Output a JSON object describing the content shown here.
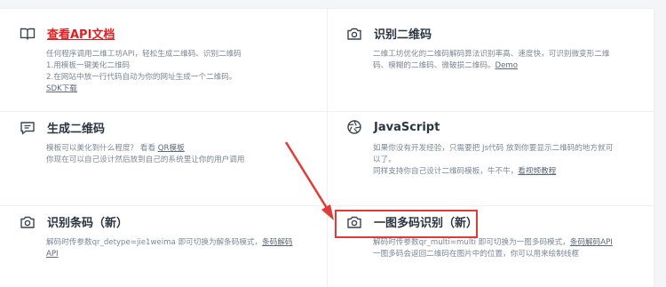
{
  "cards": {
    "api_docs": {
      "title": "查看API文档",
      "icon": "book-icon",
      "lines": [
        "任何程序调用二维工坊API，轻松生成二维码、识别二维码",
        "1.用模板一键美化二维码",
        "2.在网站中放一行代码自动为你的网址生成一个二维码。"
      ],
      "link": "SDK下载"
    },
    "recognize_qr": {
      "title": "识别二维码",
      "icon": "camera-icon",
      "lines": [
        "二维工坊优化的二维码解码算法识别率高、速度快，可识别微变形二维",
        "码、模糊的二维码、微破损二维码。"
      ],
      "link": "Demo"
    },
    "generate_qr": {
      "title": "生成二维码",
      "icon": "message-icon",
      "line1_prefix": "模板可以美化到什么程度？ 看看 ",
      "line1_link": "QR模板",
      "line2": "你现在可以自己设计然后放到自己的系统里让你的用户调用"
    },
    "javascript": {
      "title": "JavaScript",
      "icon": "aperture-icon",
      "lines": [
        "如果你没有开发经验，只需要把 Js代码 放到你要显示二维码的地方就可",
        "以了。"
      ],
      "line3_prefix": "同样支持你自己设计二维码模板，牛不牛，",
      "line3_link": "看视频教程"
    },
    "recognize_barcode": {
      "title": "识别条码（新）",
      "icon": "camera-icon",
      "line1_prefix": "解码时传参数qr_detype=jie1weima 即可切换为解条码模式，",
      "line1_link": "条码解码",
      "line2_link": "API"
    },
    "multi_qr": {
      "title": "一图多码识别（新）",
      "icon": "camera-icon",
      "line1_prefix": "解码时传参数qr_multi=multi 即可切换为一图多码模式，",
      "line1_link": "条码解码API",
      "line2": "一图多码会返回二维码在图片中的位置，你可以用来绘制线框"
    }
  },
  "colors": {
    "accent_red": "#e53935",
    "title_text": "#2b3441",
    "desc_text": "#7b8796"
  }
}
